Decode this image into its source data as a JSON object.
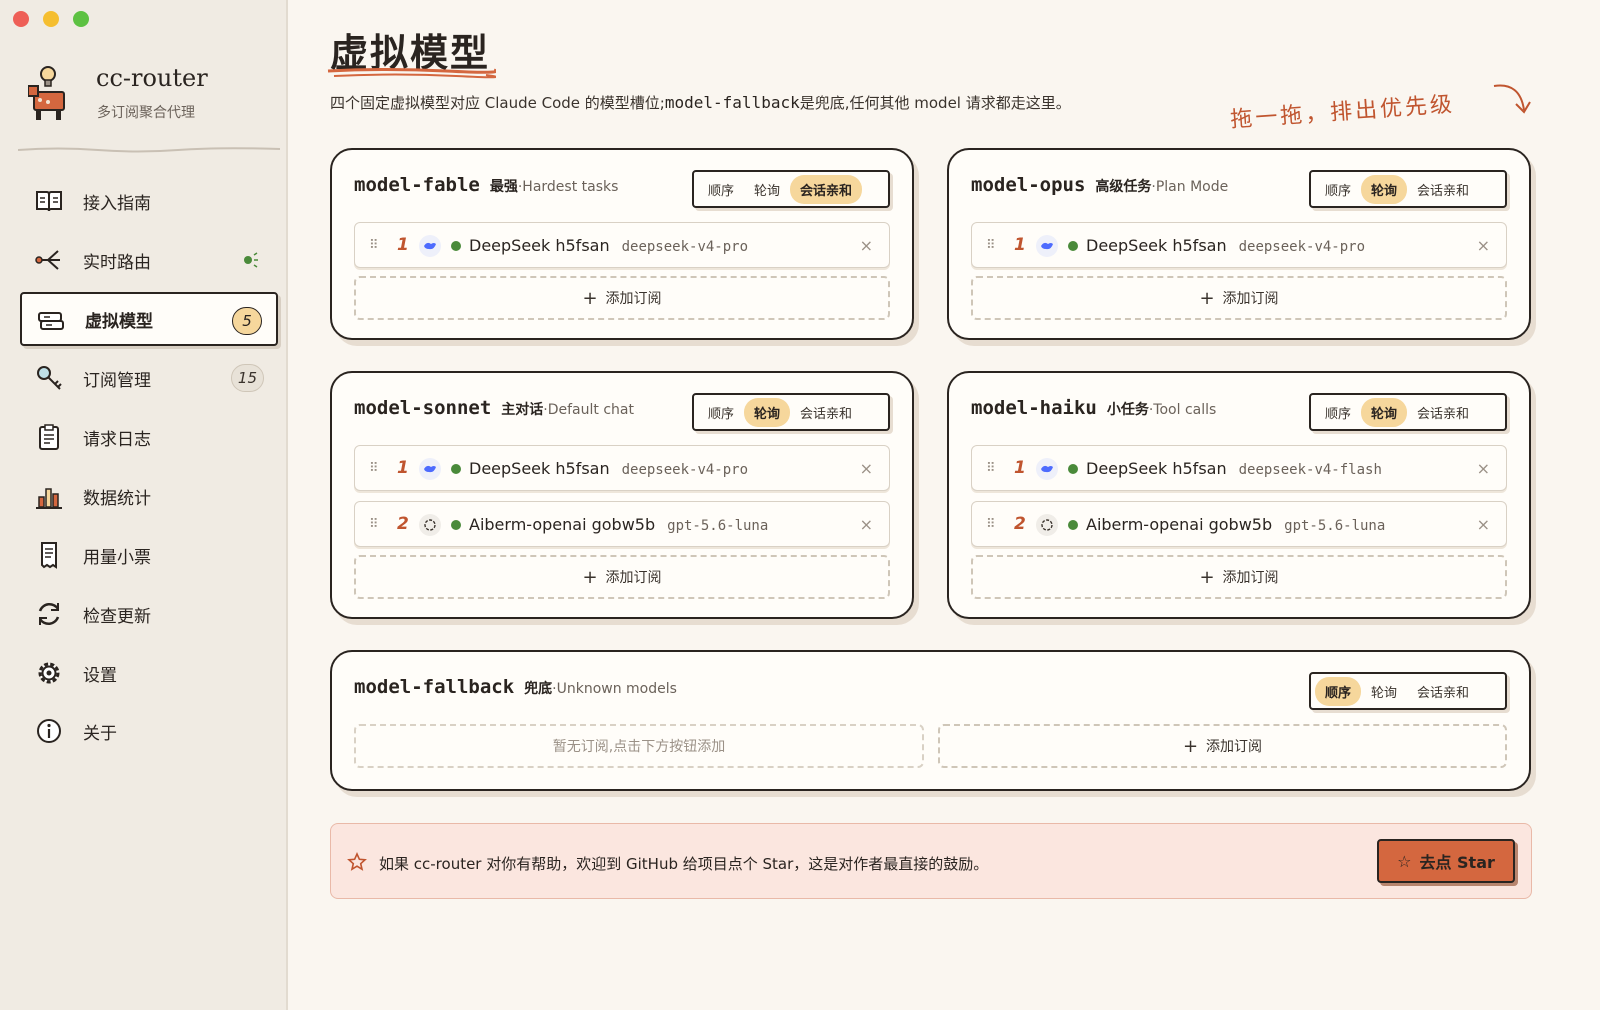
{
  "app": {
    "name": "cc-router",
    "subtitle": "多订阅聚合代理"
  },
  "sidebar": {
    "items": [
      {
        "label": "接入指南",
        "icon": "book-icon"
      },
      {
        "label": "实时路由",
        "icon": "route-icon",
        "live": true
      },
      {
        "label": "虚拟模型",
        "icon": "layers-icon",
        "badge": "5",
        "active": true
      },
      {
        "label": "订阅管理",
        "icon": "key-icon",
        "badge": "15"
      },
      {
        "label": "请求日志",
        "icon": "clipboard-icon"
      },
      {
        "label": "数据统计",
        "icon": "bar-chart-icon"
      },
      {
        "label": "用量小票",
        "icon": "receipt-icon"
      },
      {
        "label": "检查更新",
        "icon": "refresh-icon"
      },
      {
        "label": "设置",
        "icon": "gear-icon"
      },
      {
        "label": "关于",
        "icon": "info-icon"
      }
    ]
  },
  "page": {
    "title": "虚拟模型",
    "desc_pre": "四个固定虚拟模型对应 Claude Code 的模型槽位;",
    "desc_code": "model-fallback",
    "desc_post": "是兜底,任何其他 model 请求都走这里。",
    "hint": "拖一拖，排出优先级"
  },
  "strategy_options": [
    "顺序",
    "轮询",
    "会话亲和"
  ],
  "add_label": "添加订阅",
  "cards": {
    "fable": {
      "name": "model-fable",
      "tag": "最强",
      "tag_en": "·Hardest tasks",
      "selected": "会话亲和",
      "rows": [
        {
          "num": "1",
          "name": "DeepSeek h5fsan",
          "model": "deepseek-v4-pro",
          "provider": "deepseek"
        }
      ]
    },
    "opus": {
      "name": "model-opus",
      "tag": "高级任务",
      "tag_en": "·Plan Mode",
      "selected": "轮询",
      "rows": [
        {
          "num": "1",
          "name": "DeepSeek h5fsan",
          "model": "deepseek-v4-pro",
          "provider": "deepseek"
        }
      ]
    },
    "sonnet": {
      "name": "model-sonnet",
      "tag": "主对话",
      "tag_en": "·Default chat",
      "selected": "轮询",
      "rows": [
        {
          "num": "1",
          "name": "DeepSeek h5fsan",
          "model": "deepseek-v4-pro",
          "provider": "deepseek"
        },
        {
          "num": "2",
          "name": "Aiberm-openai gobw5b",
          "model": "gpt-5.6-luna",
          "provider": "openai"
        }
      ]
    },
    "haiku": {
      "name": "model-haiku",
      "tag": "小任务",
      "tag_en": "·Tool calls",
      "selected": "轮询",
      "rows": [
        {
          "num": "1",
          "name": "DeepSeek h5fsan",
          "model": "deepseek-v4-flash",
          "provider": "deepseek"
        },
        {
          "num": "2",
          "name": "Aiberm-openai gobw5b",
          "model": "gpt-5.6-luna",
          "provider": "openai"
        }
      ]
    },
    "fallback": {
      "name": "model-fallback",
      "tag": "兜底",
      "tag_en": "·Unknown models",
      "selected": "顺序",
      "empty": "暂无订阅,点击下方按钮添加"
    }
  },
  "banner": {
    "text": "如果 cc-router 对你有帮助，欢迎到 GitHub 给项目点个 Star，这是对作者最直接的鼓励。",
    "button": "去点 Star"
  },
  "colors": {
    "accent": "#d4673f",
    "highlight": "#f6d79c",
    "online": "#4a8a3a",
    "bg": "#faf6f0"
  }
}
